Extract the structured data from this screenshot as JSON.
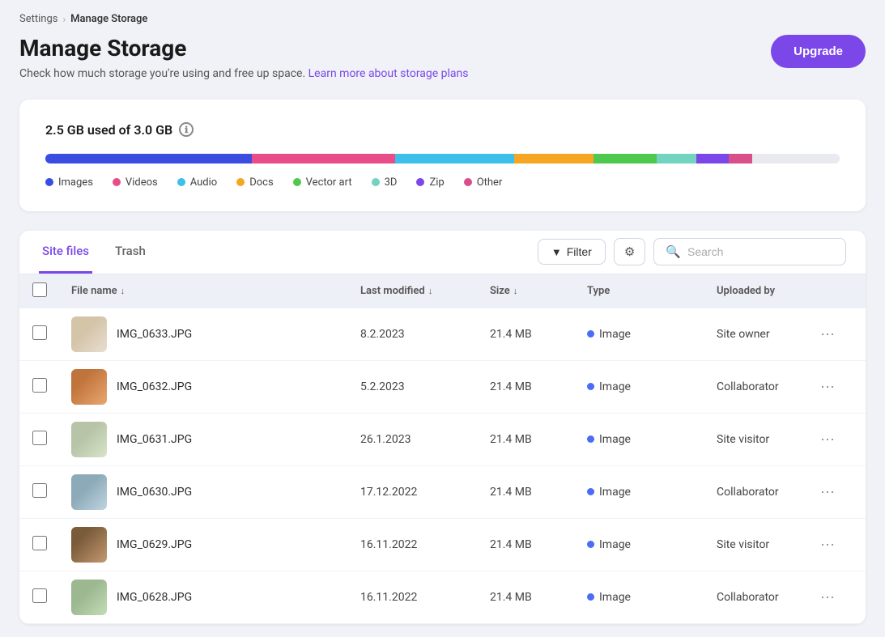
{
  "breadcrumb": {
    "parent": "Settings",
    "separator": "›",
    "current": "Manage Storage"
  },
  "page": {
    "title": "Manage Storage",
    "subtitle": "Check how much storage you're using and free up space.",
    "subtitle_link_text": "Learn more about storage plans",
    "upgrade_label": "Upgrade"
  },
  "storage": {
    "label": "2.5 GB used of 3.0 GB",
    "info_icon": "ℹ",
    "bar_segments": [
      {
        "label": "Images",
        "color": "#3b4de0",
        "pct": 26
      },
      {
        "label": "Videos",
        "color": "#e84d8a",
        "pct": 18
      },
      {
        "label": "Audio",
        "color": "#3cbfe8",
        "pct": 15
      },
      {
        "label": "Docs",
        "color": "#f5a623",
        "pct": 10
      },
      {
        "label": "Vector art",
        "color": "#4ec94e",
        "pct": 8
      },
      {
        "label": "3D",
        "color": "#72d3c0",
        "pct": 5
      },
      {
        "label": "Zip",
        "color": "#7b47e8",
        "pct": 4
      },
      {
        "label": "Other",
        "color": "#d94f8a",
        "pct": 3
      }
    ],
    "legend": [
      {
        "label": "Images",
        "color": "#3b4de0"
      },
      {
        "label": "Videos",
        "color": "#e84d8a"
      },
      {
        "label": "Audio",
        "color": "#3cbfe8"
      },
      {
        "label": "Docs",
        "color": "#f5a623"
      },
      {
        "label": "Vector art",
        "color": "#4ec94e"
      },
      {
        "label": "3D",
        "color": "#72d3c0"
      },
      {
        "label": "Zip",
        "color": "#7b47e8"
      },
      {
        "label": "Other",
        "color": "#d94f8a"
      }
    ]
  },
  "tabs": [
    {
      "id": "site-files",
      "label": "Site files",
      "active": true
    },
    {
      "id": "trash",
      "label": "Trash",
      "active": false
    }
  ],
  "toolbar": {
    "filter_label": "Filter",
    "search_placeholder": "Search"
  },
  "table": {
    "columns": [
      {
        "label": "File name",
        "sortable": true
      },
      {
        "label": "Last modified",
        "sortable": true
      },
      {
        "label": "Size",
        "sortable": true
      },
      {
        "label": "Type",
        "sortable": false
      },
      {
        "label": "Uploaded by",
        "sortable": false
      }
    ],
    "rows": [
      {
        "id": 1,
        "filename": "IMG_0633.JPG",
        "modified": "8.2.2023",
        "size": "21.4 MB",
        "type": "Image",
        "uploaded_by": "Site owner",
        "thumb_color": "#c8b9a8"
      },
      {
        "id": 2,
        "filename": "IMG_0632.JPG",
        "modified": "5.2.2023",
        "size": "21.4 MB",
        "type": "Image",
        "uploaded_by": "Collaborator",
        "thumb_color": "#c0733a"
      },
      {
        "id": 3,
        "filename": "IMG_0631.JPG",
        "modified": "26.1.2023",
        "size": "21.4 MB",
        "type": "Image",
        "uploaded_by": "Site visitor",
        "thumb_color": "#b8c4a8"
      },
      {
        "id": 4,
        "filename": "IMG_0630.JPG",
        "modified": "17.12.2022",
        "size": "21.4 MB",
        "type": "Image",
        "uploaded_by": "Collaborator",
        "thumb_color": "#8caab8"
      },
      {
        "id": 5,
        "filename": "IMG_0629.JPG",
        "modified": "16.11.2022",
        "size": "21.4 MB",
        "type": "Image",
        "uploaded_by": "Site visitor",
        "thumb_color": "#7a5c3a"
      },
      {
        "id": 6,
        "filename": "IMG_0628.JPG",
        "modified": "16.11.2022",
        "size": "21.4 MB",
        "type": "Image",
        "uploaded_by": "Collaborator",
        "thumb_color": "#9bb890"
      }
    ]
  },
  "icons": {
    "filter": "⊟",
    "search": "🔍",
    "more": "•••"
  }
}
